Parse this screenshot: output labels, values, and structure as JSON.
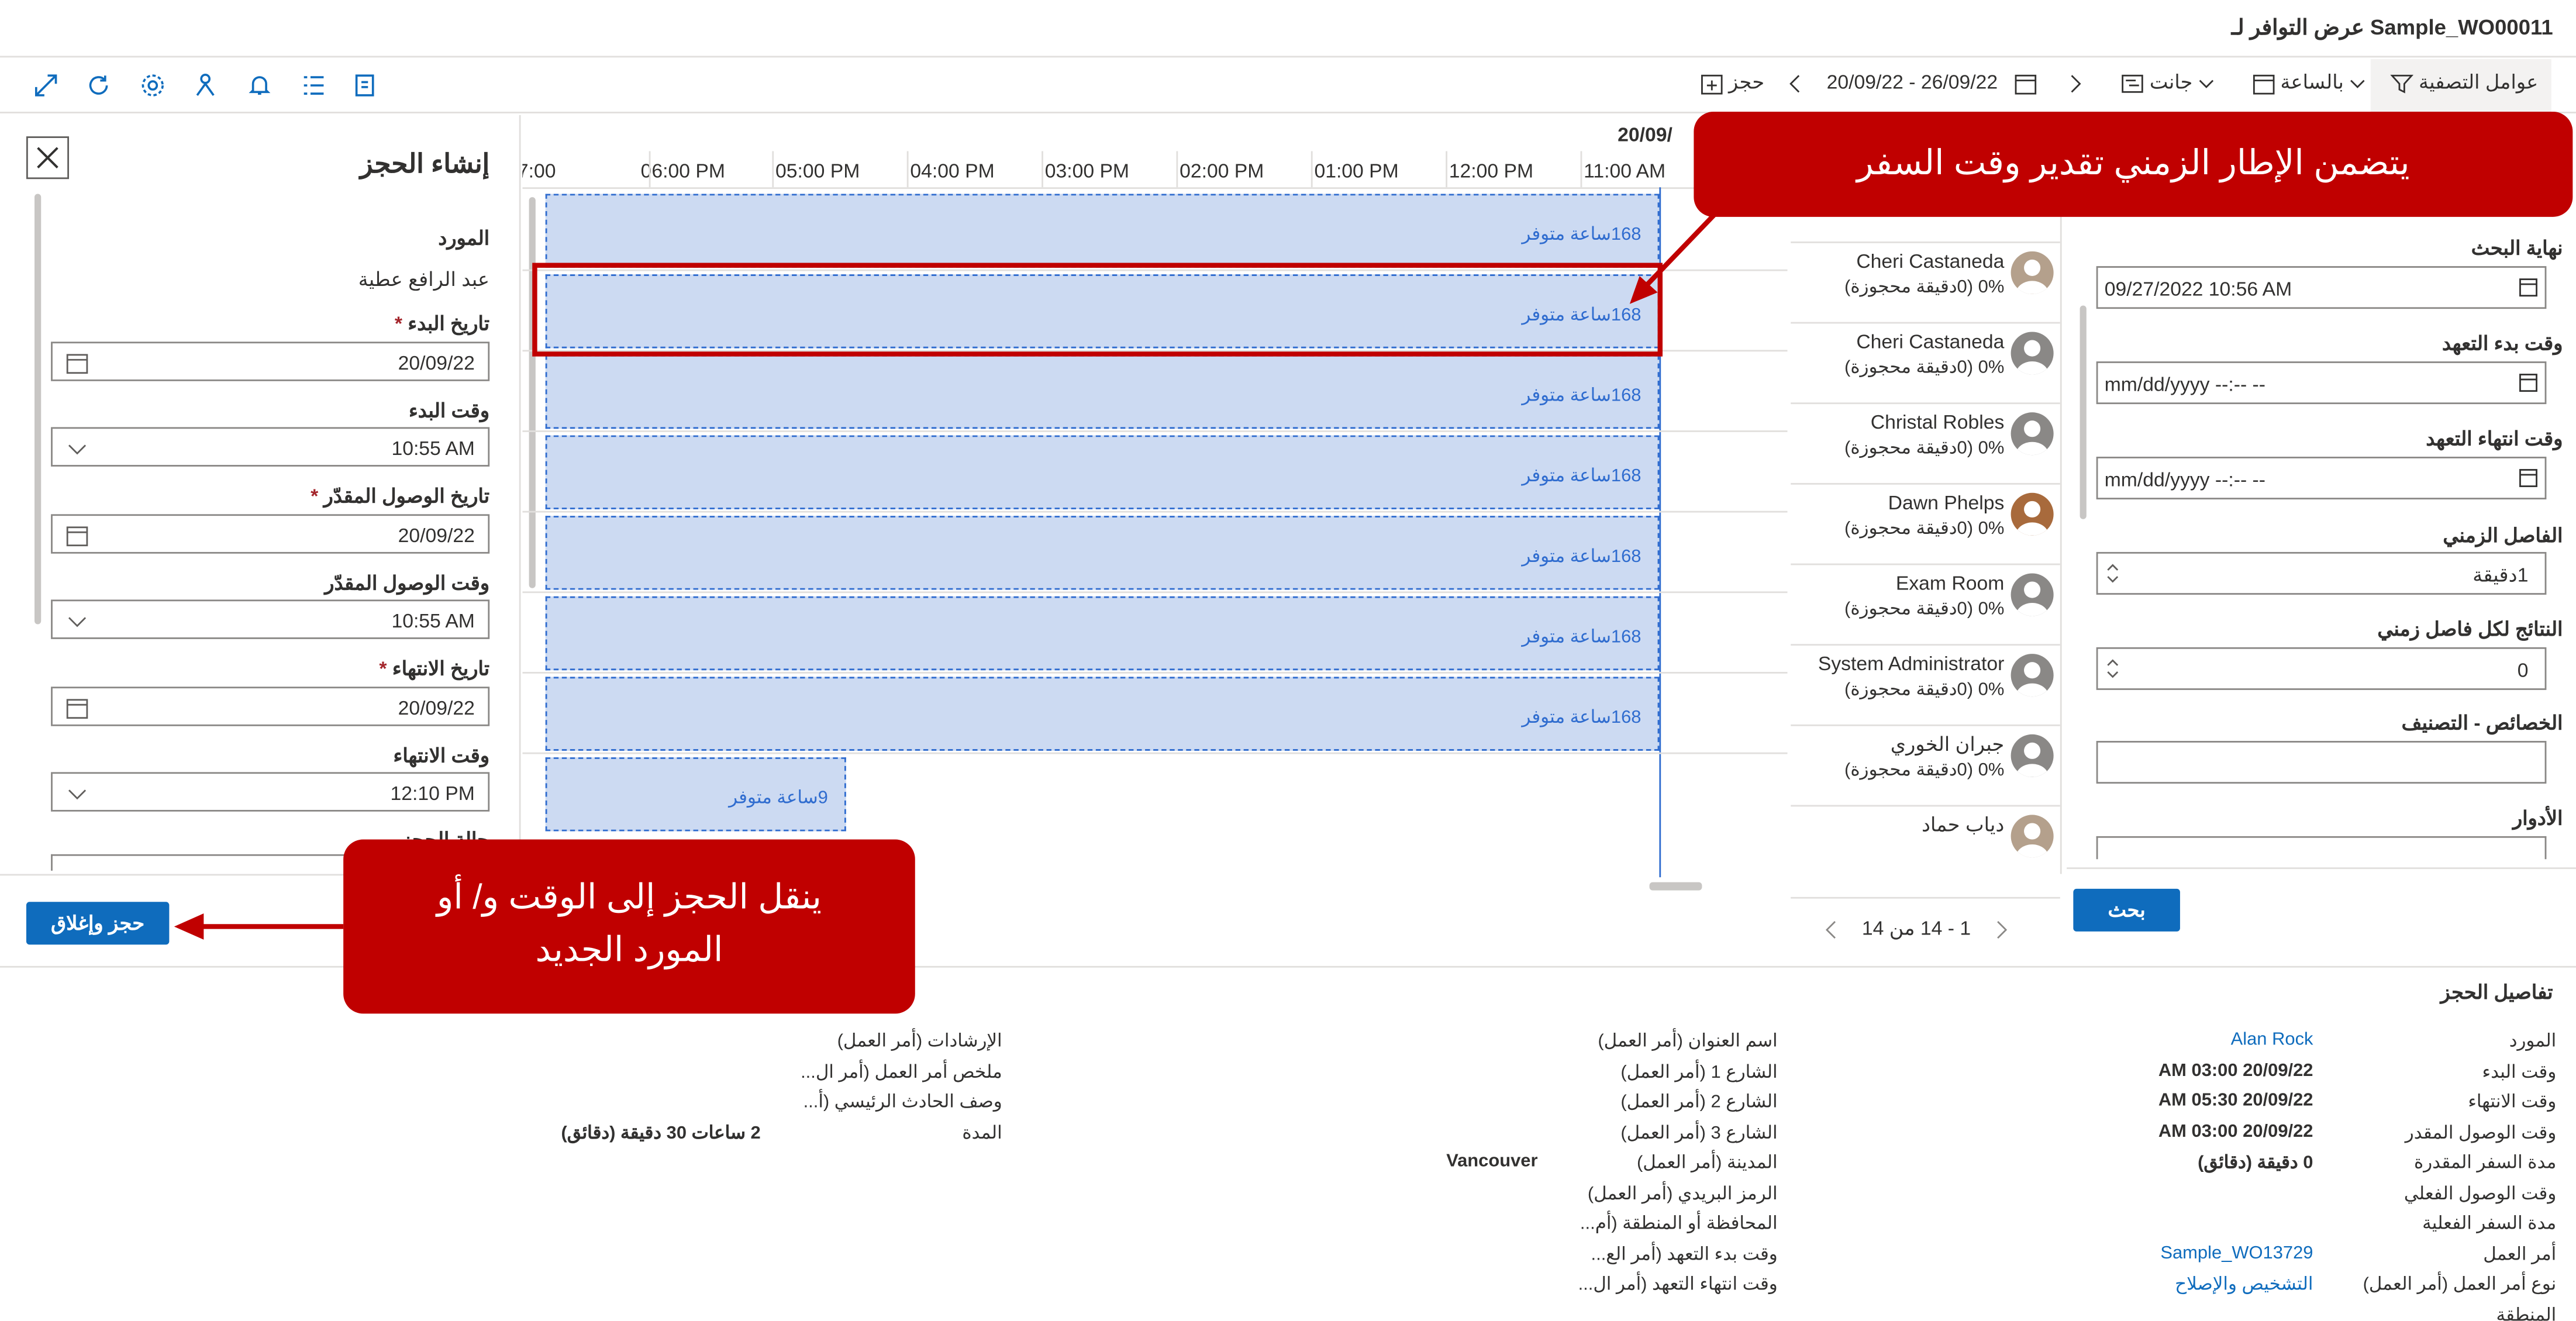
{
  "window_title": "عرض التوافر لـ Sample_WO00011",
  "toolbar": {
    "filter": "عوامل التصفية",
    "hourly": "بالساعة",
    "gantt": "جانت",
    "date_range": "20/09/22 - 26/09/22",
    "book": "حجز"
  },
  "create_booking": {
    "title": "إنشاء الحجز",
    "resource_label": "المورد",
    "resource_value": "عبد الرافع عطية",
    "start_date_label": "تاريخ البدء",
    "start_date_value": "20/09/22",
    "start_time_label": "وقت البدء",
    "start_time_value": "10:55 AM",
    "est_arrival_date_label": "تاريخ الوصول المقدّر",
    "est_arrival_date_value": "20/09/22",
    "est_arrival_time_label": "وقت الوصول المقدّر",
    "est_arrival_time_value": "10:55 AM",
    "end_date_label": "تاريخ الانتهاء",
    "end_date_value": "20/09/22",
    "end_time_label": "وقت الانتهاء",
    "end_time_value": "12:10 PM",
    "cut_label": "حالة الحجز",
    "book_close": "حجز وإغلاق",
    "required_mark": "*"
  },
  "schedule": {
    "date_header": "20/09/",
    "hours": [
      "11:00 AM",
      "12:00 PM",
      "01:00 PM",
      "02:00 PM",
      "03:00 PM",
      "04:00 PM",
      "05:00 PM",
      "06:00 PM",
      "7:00"
    ],
    "am_partial": "A",
    "slot_label": "168ساعة متوفر",
    "slot_label_short": "9ساعة متوفر"
  },
  "resources": [
    {
      "name": "",
      "status": "0% (0دقيقة محجوزة)"
    },
    {
      "name": "Cheri Castaneda",
      "status": "0% (0دقيقة محجوزة)"
    },
    {
      "name": "Cheri Castaneda",
      "status": "0% (0دقيقة محجوزة)"
    },
    {
      "name": "Christal Robles",
      "status": "0% (0دقيقة محجوزة)"
    },
    {
      "name": "Dawn Phelps",
      "status": "0% (0دقيقة محجوزة)"
    },
    {
      "name": "Exam Room",
      "status": "0% (0دقيقة محجوزة)"
    },
    {
      "name": "System Administrator",
      "status": "0% (0دقيقة محجوزة)"
    },
    {
      "name": "جبران الخوري",
      "status": "0% (0دقيقة محجوزة)"
    },
    {
      "name": "دياب حماد",
      "status": ""
    }
  ],
  "pager": "1 - 14 من 14",
  "search_panel": {
    "search_end_label": "نهاية البحث",
    "search_end_value": "09/27/2022 10:56 AM",
    "promise_start_label": "وقت بدء التعهد",
    "promise_start_value": "mm/dd/yyyy --:-- --",
    "promise_end_label": "وقت انتهاء التعهد",
    "promise_end_value": "mm/dd/yyyy --:-- --",
    "interval_label": "الفاصل الزمني",
    "interval_value": "1دقيقة",
    "results_label": "النتائج لكل فاصل زمني",
    "results_value": "0",
    "chars_label": "الخصائص - التصنيف",
    "roles_label": "الأدوار",
    "search_button": "بحث"
  },
  "details": {
    "title": "تفاصيل الحجز",
    "col1": [
      {
        "k": "المورد",
        "v": "Alan Rock",
        "link": true
      },
      {
        "k": "وقت البدء",
        "v": "20/09/22 03:00 AM"
      },
      {
        "k": "وقت الانتهاء",
        "v": "20/09/22 05:30 AM"
      },
      {
        "k": "وقت الوصول المقدر",
        "v": "20/09/22 03:00 AM"
      },
      {
        "k": "مدة السفر المقدرة",
        "v": "0 دقيقة (دقائق)"
      },
      {
        "k": "وقت الوصول الفعلي",
        "v": ""
      },
      {
        "k": "مدة السفر الفعلية",
        "v": ""
      },
      {
        "k": "أمر العمل",
        "v": "Sample_WO13729",
        "link": true
      },
      {
        "k": "نوع أمر العمل (أمر العمل)",
        "v": "التشخيص والإصلاح",
        "link": true
      },
      {
        "k": "المنطقة",
        "v": ""
      }
    ],
    "col2": [
      {
        "k": "اسم العنوان (أمر العمل)",
        "v": ""
      },
      {
        "k": "الشارع 1 (أمر العمل)",
        "v": ""
      },
      {
        "k": "الشارع 2 (أمر العمل)",
        "v": ""
      },
      {
        "k": "الشارع 3 (أمر العمل)",
        "v": ""
      },
      {
        "k": "المدينة (أمر العمل)",
        "v": "Vancouver"
      },
      {
        "k": "الرمز البريدي (أمر العمل)",
        "v": ""
      },
      {
        "k": "المحافظة أو المنطقة (أم...",
        "v": ""
      },
      {
        "k": "وقت بدء التعهد (أمر الع...",
        "v": ""
      },
      {
        "k": "وقت انتهاء التعهد (أمر ال...",
        "v": ""
      }
    ],
    "col3": [
      {
        "k": "الإرشادات (أمر العمل)",
        "v": ""
      },
      {
        "k": "ملخص أمر العمل (أمر ال...",
        "v": ""
      },
      {
        "k": "وصف الحادث الرئيسي (أ...",
        "v": ""
      },
      {
        "k": "المدة",
        "v": "2 ساعات 30 دقيقة (دقائق)"
      }
    ]
  },
  "callouts": {
    "travel": "يتضمن الإطار الزمني تقدير وقت السفر",
    "move_line1": "ينقل الحجز إلى الوقت و/ أو",
    "move_line2": "المورد الجديد"
  },
  "colors": {
    "accent": "#0f6cbd",
    "slot_fill": "#ccdaf2",
    "slot_border": "#2f6ccf",
    "callout": "#c00000"
  }
}
